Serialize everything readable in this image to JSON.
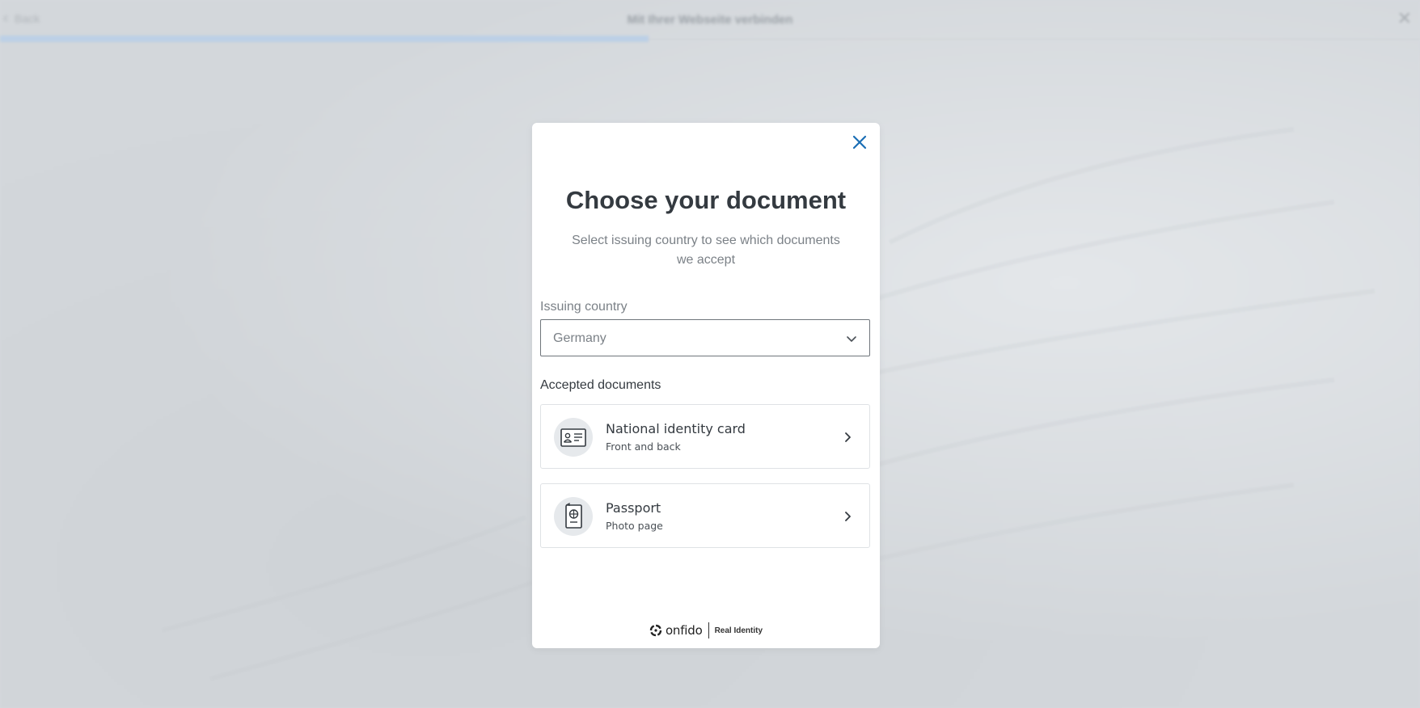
{
  "background": {
    "back_label": "Back",
    "title": "Mit Ihrer Webseite verbinden",
    "progress_percent": 45.7
  },
  "modal": {
    "title": "Choose your document",
    "subtitle": "Select issuing country to see which documents we accept",
    "country": {
      "label": "Issuing country",
      "selected": "Germany"
    },
    "accepted_label": "Accepted documents",
    "documents": [
      {
        "title": "National identity card",
        "subtitle": "Front and back",
        "icon": "id-card-icon"
      },
      {
        "title": "Passport",
        "subtitle": "Photo page",
        "icon": "passport-icon"
      }
    ],
    "footer": {
      "brand": "onfido",
      "tagline": "Real Identity"
    }
  },
  "colors": {
    "accent": "#1a6eb5",
    "text_dark": "#343a40",
    "text_muted": "#7b8187"
  }
}
